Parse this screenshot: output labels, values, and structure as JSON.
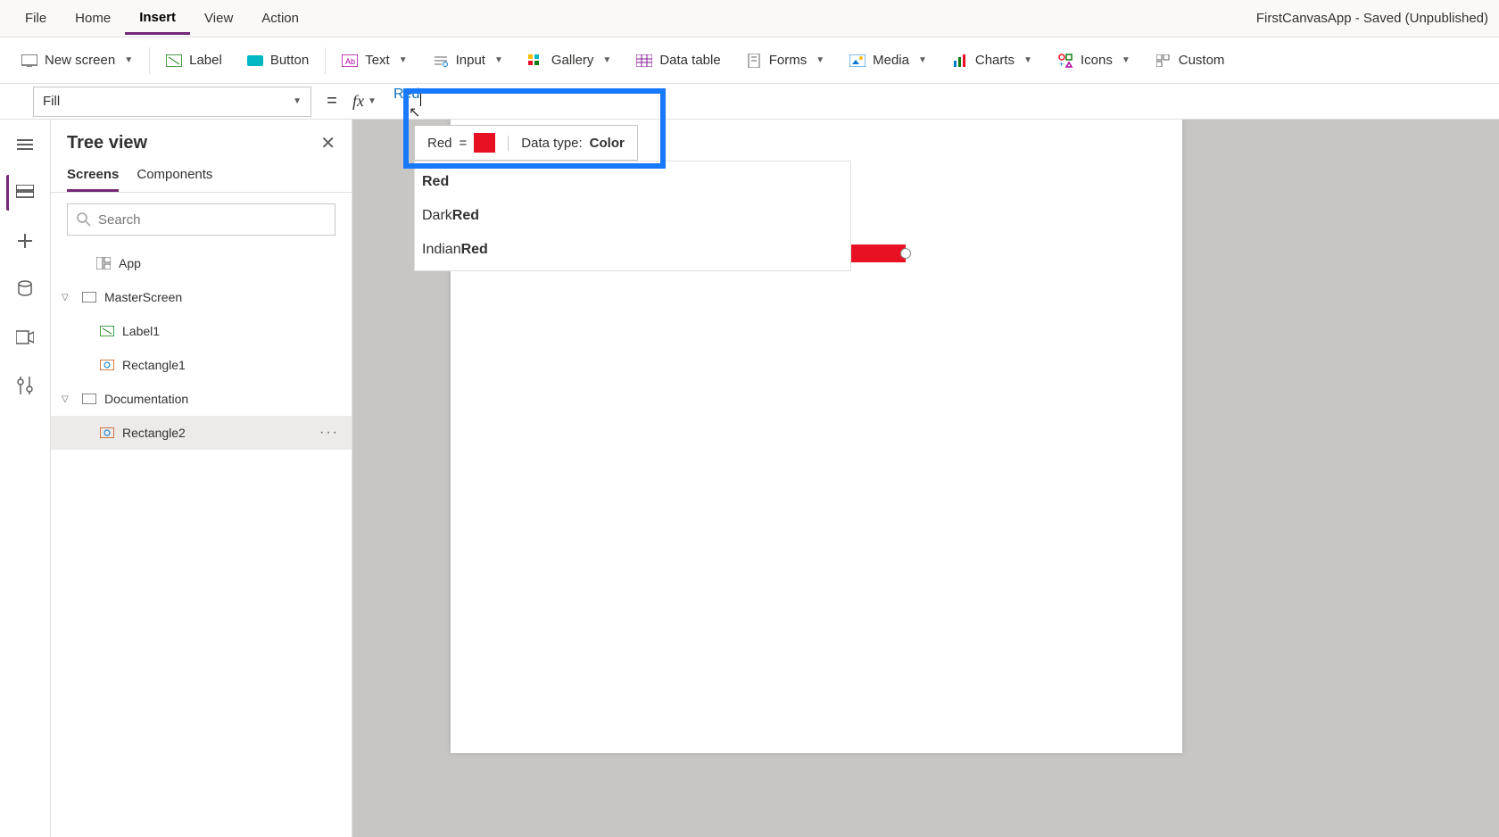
{
  "app_title": "FirstCanvasApp - Saved (Unpublished)",
  "menu": {
    "items": [
      "File",
      "Home",
      "Insert",
      "View",
      "Action"
    ],
    "active": "Insert"
  },
  "toolbar": {
    "new_screen": "New screen",
    "label": "Label",
    "button": "Button",
    "text": "Text",
    "input": "Input",
    "gallery": "Gallery",
    "data_table": "Data table",
    "forms": "Forms",
    "media": "Media",
    "charts": "Charts",
    "icons": "Icons",
    "custom": "Custom"
  },
  "formula": {
    "property": "Fill",
    "value": "Red",
    "tooltip_name": "Red",
    "tooltip_eq": "=",
    "tooltip_datatype_label": "Data type: ",
    "tooltip_datatype_value": "Color",
    "swatch_color": "#e81123"
  },
  "suggestions": [
    {
      "prefix": "",
      "match": "Red"
    },
    {
      "prefix": "Dark",
      "match": "Red"
    },
    {
      "prefix": "Indian",
      "match": "Red"
    }
  ],
  "panel": {
    "title": "Tree view",
    "tabs": [
      "Screens",
      "Components"
    ],
    "active_tab": "Screens",
    "search_placeholder": "Search"
  },
  "tree": {
    "app": "App",
    "screen1": "MasterScreen",
    "screen1_children": [
      "Label1",
      "Rectangle1"
    ],
    "screen2": "Documentation",
    "screen2_children": [
      "Rectangle2"
    ],
    "selected": "Rectangle2"
  }
}
